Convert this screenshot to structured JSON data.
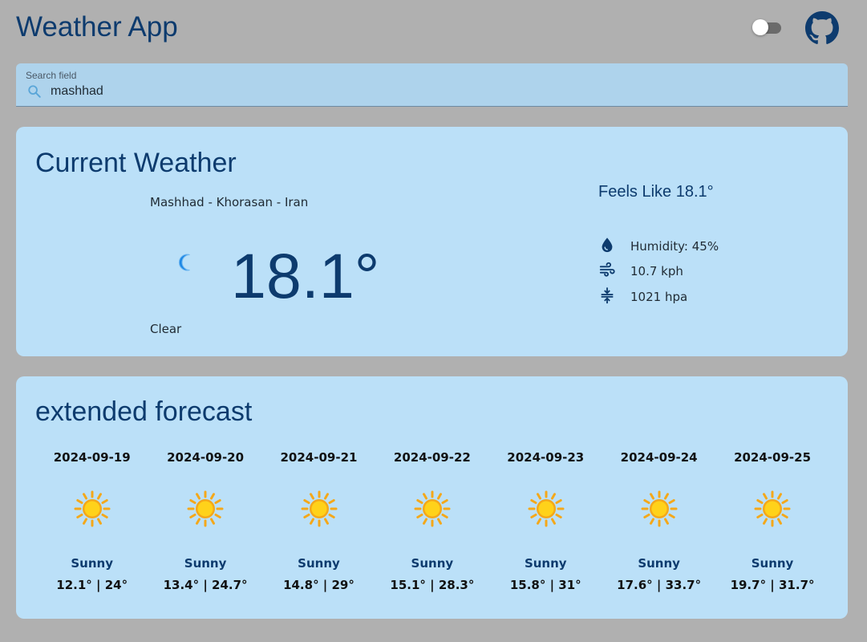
{
  "app": {
    "title": "Weather App",
    "dark_mode_on": false,
    "github_icon": "github-icon"
  },
  "search": {
    "label": "Search field",
    "value": "mashhad",
    "icon": "search-icon"
  },
  "current": {
    "title": "Current Weather",
    "location": "Mashhad - Khorasan - Iran",
    "temperature": "18.1°",
    "condition": "Clear",
    "condition_icon": "moon-icon",
    "feels_like": "Feels Like 18.1°",
    "details": [
      {
        "icon": "water-drop-icon",
        "text": "Humidity: 45%"
      },
      {
        "icon": "wind-icon",
        "text": "10.7 kph"
      },
      {
        "icon": "pressure-icon",
        "text": "1021 hpa"
      }
    ]
  },
  "forecast": {
    "title": "extended forecast",
    "days": [
      {
        "date": "2024-09-19",
        "condition": "Sunny",
        "range": "12.1° | 24°",
        "icon": "sun-icon"
      },
      {
        "date": "2024-09-20",
        "condition": "Sunny",
        "range": "13.4° | 24.7°",
        "icon": "sun-icon"
      },
      {
        "date": "2024-09-21",
        "condition": "Sunny",
        "range": "14.8° | 29°",
        "icon": "sun-icon"
      },
      {
        "date": "2024-09-22",
        "condition": "Sunny",
        "range": "15.1° | 28.3°",
        "icon": "sun-icon"
      },
      {
        "date": "2024-09-23",
        "condition": "Sunny",
        "range": "15.8° | 31°",
        "icon": "sun-icon"
      },
      {
        "date": "2024-09-24",
        "condition": "Sunny",
        "range": "17.6° | 33.7°",
        "icon": "sun-icon"
      },
      {
        "date": "2024-09-25",
        "condition": "Sunny",
        "range": "19.7° | 31.7°",
        "icon": "sun-icon"
      }
    ]
  },
  "colors": {
    "background": "#b0b0b0",
    "card": "#bbe0f8",
    "search_bg": "#aed3ec",
    "primary_text": "#0d3b6e",
    "sun_core": "#ffd21a",
    "sun_rays": "#f4a81a",
    "moon": "#1e88e5"
  }
}
